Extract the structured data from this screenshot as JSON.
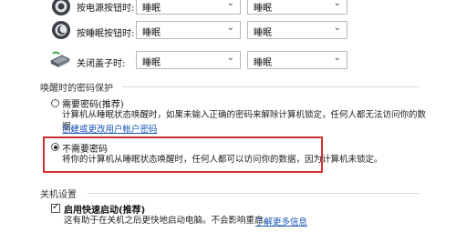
{
  "power_rows": [
    {
      "label": "按电源按钮时:",
      "plugged": "睡眠",
      "battery": "睡眠",
      "icon": "power-icon"
    },
    {
      "label": "按睡眠按钮时:",
      "plugged": "睡眠",
      "battery": "睡眠",
      "icon": "sleep-button-icon"
    },
    {
      "label": "关闭盖子时:",
      "plugged": "睡眠",
      "battery": "睡眠",
      "icon": "laptop-lid-icon"
    }
  ],
  "wake_password": {
    "title": "唤醒时的密码保护",
    "require": {
      "label": "需要密码(推荐)",
      "desc": "计算机从睡眠状态唤醒时，如果未输入正确的密码来解除计算机锁定，任何人都无法访问你的数据。",
      "link": "创建或更改用户帐户密码"
    },
    "no_require": {
      "label": "不需要密码",
      "desc": "将你的计算机从睡眠状态唤醒时，任何人都可以访问你的数据，因为计算机未锁定。"
    }
  },
  "shutdown": {
    "title": "关机设置",
    "fast_startup": {
      "label": "启用快速启动(推荐)",
      "desc": "这有助于在关机之后更快地启动电脑。不会影响重启。",
      "link": "了解更多信息"
    }
  }
}
